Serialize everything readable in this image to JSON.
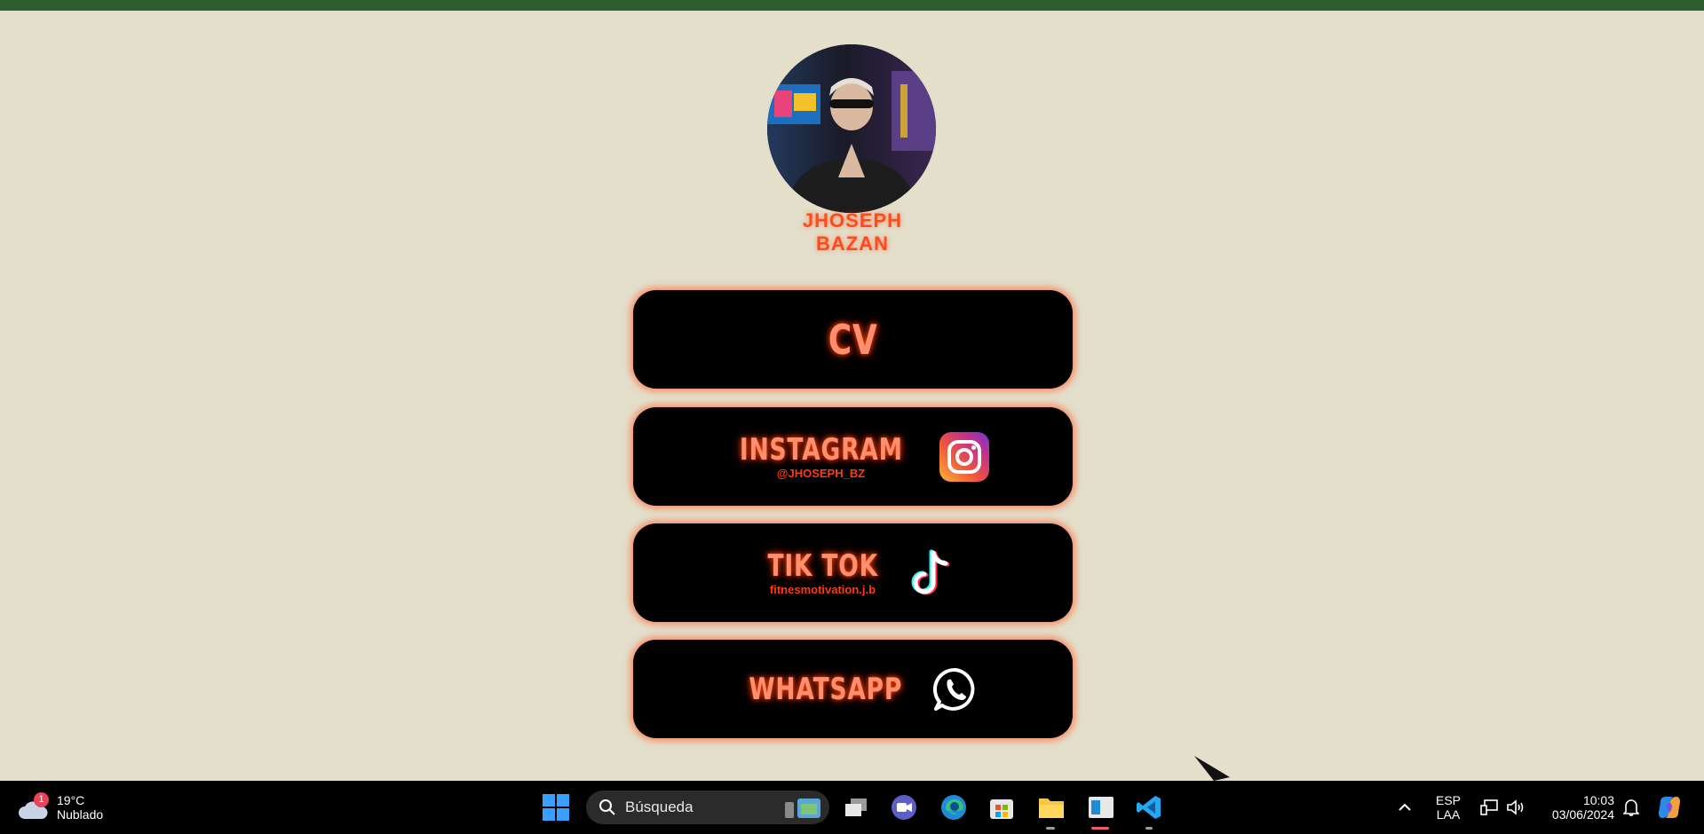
{
  "profile": {
    "name_line1": "JHOSEPH",
    "name_line2": "BAZAN"
  },
  "buttons": {
    "cv": {
      "label": "CV"
    },
    "instagram": {
      "label": "INSTAGRAM",
      "handle": "@JHOSEPH_BZ",
      "icon": "instagram-icon"
    },
    "tiktok": {
      "label": "TIK TOK",
      "handle": "fitnesmotivation.j.b",
      "icon": "tiktok-icon"
    },
    "whatsapp": {
      "label": "WHATSAPP",
      "icon": "whatsapp-icon"
    }
  },
  "colors": {
    "accent": "#ff4a1c",
    "glow": "#ff8f6e",
    "page_bg": "#e3dfcb",
    "top_bar": "#2e5e2e"
  },
  "taskbar": {
    "weather": {
      "badge": "1",
      "temp": "19°C",
      "condition": "Nublado"
    },
    "search_label": "Búsqueda",
    "language": {
      "line1": "ESP",
      "line2": "LAA"
    },
    "clock": {
      "time": "10:03",
      "date": "03/06/2024"
    }
  }
}
